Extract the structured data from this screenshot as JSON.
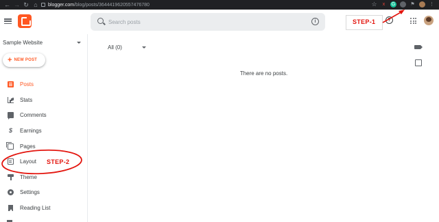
{
  "browser": {
    "url_host": "blogger.com",
    "url_path": "/blog/posts/3644419620557476780",
    "nav_icons": [
      "back-icon",
      "forward-icon",
      "reload-icon",
      "home-icon"
    ]
  },
  "header": {
    "logo": "blogger-logo-icon",
    "search": {
      "placeholder": "Search posts"
    },
    "icons": [
      "info-icon",
      "help-icon",
      "apps-icon",
      "avatar"
    ]
  },
  "annotations": {
    "step1": "STEP-1",
    "step2": "STEP-2",
    "color": "#e3150e"
  },
  "sidebar": {
    "blog_name": "Sample Website",
    "new_post_label": "NEW POST",
    "items": [
      {
        "label": "Posts",
        "icon": "posts-icon",
        "active": true
      },
      {
        "label": "Stats",
        "icon": "stats-icon"
      },
      {
        "label": "Comments",
        "icon": "comments-icon"
      },
      {
        "label": "Earnings",
        "icon": "earnings-icon"
      },
      {
        "label": "Pages",
        "icon": "pages-icon"
      },
      {
        "label": "Layout",
        "icon": "layout-icon"
      },
      {
        "label": "Theme",
        "icon": "theme-icon"
      },
      {
        "label": "Settings",
        "icon": "settings-icon"
      },
      {
        "label": "Reading List",
        "icon": "reading-list-icon"
      }
    ]
  },
  "main": {
    "filter_label": "All (0)",
    "empty_message": "There are no posts."
  },
  "colors": {
    "accent": "#ff5722",
    "text": "#3c4043",
    "icon": "#5f6368",
    "search_bg": "#ebedef",
    "chrome_bg": "#202124"
  }
}
